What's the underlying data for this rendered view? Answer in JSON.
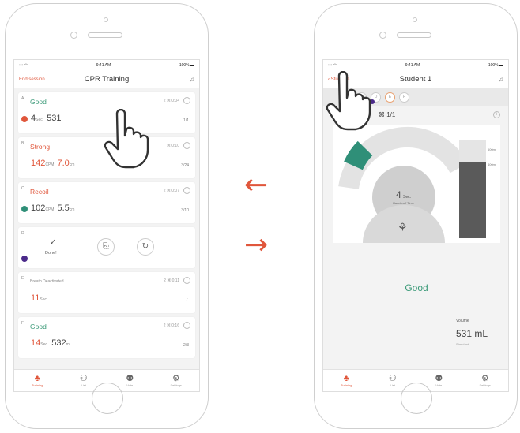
{
  "colors": {
    "accent": "#e0563b",
    "teal": "#2f8f78",
    "purple": "#4b2a8a"
  },
  "left": {
    "status": {
      "time": "9:41 AM",
      "battery": "100%"
    },
    "nav": {
      "left": "End session",
      "title": "CPR Training"
    },
    "cards": [
      {
        "letter": "A",
        "status": "Good",
        "meta": "0:04",
        "value": "4",
        "unit": "Sec.",
        "value2": "531",
        "unit2": "",
        "count": "1/1",
        "dot": "#e0563b",
        "status_color": "green"
      },
      {
        "letter": "B",
        "status": "Strong",
        "meta": "0:10",
        "value": "142",
        "unit": "CPM",
        "value2": "7.0",
        "unit2": "cm",
        "count": "3/24",
        "dot": "",
        "status_color": "red"
      },
      {
        "letter": "C",
        "status": "Recoil",
        "meta": "0:07",
        "value": "102",
        "unit": "CPM",
        "value2": "5.5",
        "unit2": "cm",
        "count": "3/10",
        "dot": "#2f8f78",
        "status_color": "red"
      },
      {
        "letter": "D",
        "status": "",
        "done": "Done!",
        "dot": "#4b2a8a"
      },
      {
        "letter": "E",
        "status": "Breath Deactivated",
        "meta": "0:11",
        "value": "11",
        "unit": "Sec.",
        "count": "-/-",
        "status_color": "grey"
      },
      {
        "letter": "F",
        "status": "Good",
        "meta": "0:16",
        "value": "14",
        "unit": "Sec.",
        "value2": "532",
        "unit2": "mL",
        "count": "2/3",
        "status_color": "green"
      }
    ],
    "tabs": [
      "Training",
      "List",
      "Vote",
      "Settings"
    ]
  },
  "right": {
    "status": {
      "time": "9:41 AM",
      "battery": "100%"
    },
    "nav": {
      "left": "Students",
      "title": "Student 1"
    },
    "cycle": "1/1",
    "gauge": {
      "value": "4",
      "unit": "Sec.",
      "sub": "Hands-off Time"
    },
    "bar_labels": [
      "600ml",
      "400ml"
    ],
    "result": "Good",
    "volume": {
      "label": "Volume",
      "value": "531 mL",
      "sub": "Standard"
    },
    "tabs": [
      "Training",
      "List",
      "Vote",
      "Settings"
    ]
  }
}
